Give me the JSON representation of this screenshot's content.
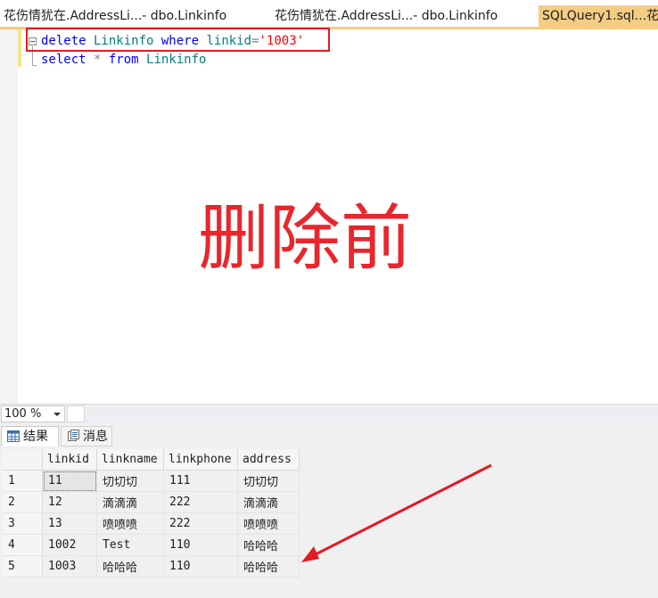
{
  "tabs": [
    {
      "label": "花伤情犹在.AddressLi...- dbo.Linkinfo",
      "active": false
    },
    {
      "label": "花伤情犹在.AddressLi...- dbo.Linkinfo",
      "active": false
    },
    {
      "label": "SQLQuery1.sql...花",
      "active": true
    }
  ],
  "editor": {
    "line1": {
      "kw1": "delete",
      "t1": " Linkinfo ",
      "kw2": "where",
      "t2": " linkid",
      "op": "=",
      "str": "'1003'"
    },
    "line2": {
      "kw1": "select",
      "op": " * ",
      "kw2": "from",
      "t1": " Linkinfo"
    },
    "annotation": "删除前"
  },
  "zoom": {
    "value": "100 %"
  },
  "result_tabs": {
    "results": "结果",
    "messages": "消息"
  },
  "grid": {
    "columns": [
      "linkid",
      "linkname",
      "linkphone",
      "address"
    ],
    "rows": [
      {
        "n": "1",
        "cells": [
          "11",
          "切切切",
          "111",
          "切切切"
        ]
      },
      {
        "n": "2",
        "cells": [
          "12",
          "滴滴滴",
          "222",
          "滴滴滴"
        ]
      },
      {
        "n": "3",
        "cells": [
          "13",
          "喷喷喷",
          "222",
          "喷喷喷"
        ]
      },
      {
        "n": "4",
        "cells": [
          "1002",
          "Test",
          "110",
          "哈哈哈"
        ]
      },
      {
        "n": "5",
        "cells": [
          "1003",
          "哈哈哈",
          "110",
          "哈哈哈"
        ]
      }
    ]
  },
  "colors": {
    "highlight": "#e01b24",
    "active_tab": "#f5cc84",
    "keyword": "#0000ff",
    "string": "#ff0000"
  }
}
